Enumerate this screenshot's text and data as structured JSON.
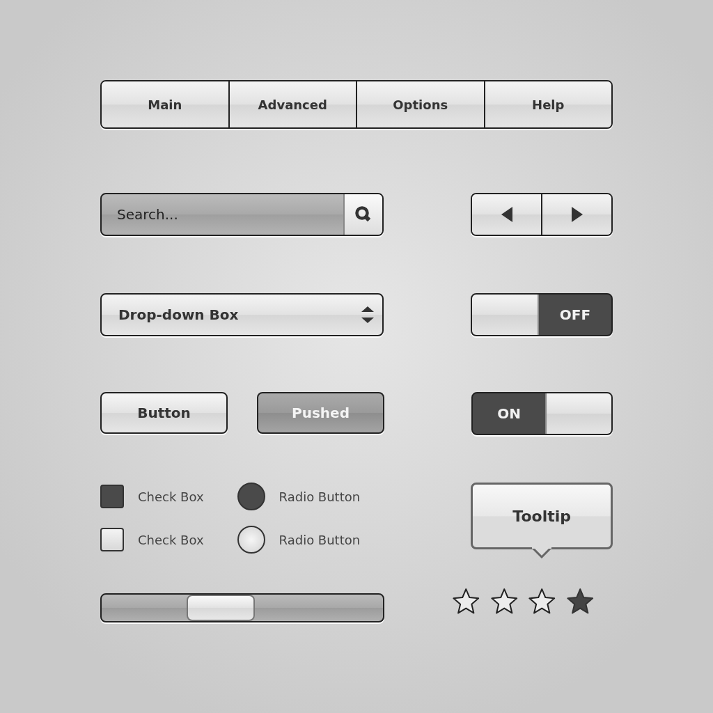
{
  "nav_tabs": [
    {
      "label": "Main"
    },
    {
      "label": "Advanced"
    },
    {
      "label": "Options"
    },
    {
      "label": "Help"
    }
  ],
  "search": {
    "placeholder": "Search..."
  },
  "dropdown": {
    "value": "Drop-down Box"
  },
  "buttons": [
    {
      "label": "Button",
      "pressed": false
    },
    {
      "label": "Pushed",
      "pressed": true
    }
  ],
  "toggles": [
    {
      "label": "OFF",
      "on": false
    },
    {
      "label": "ON",
      "on": true
    }
  ],
  "checkboxes": [
    {
      "label": "Check Box",
      "checked": true
    },
    {
      "label": "Check Box",
      "checked": false
    }
  ],
  "radios": [
    {
      "label": "Radio Button",
      "selected": true
    },
    {
      "label": "Radio Button",
      "selected": false
    }
  ],
  "tooltip": {
    "text": "Tooltip"
  },
  "slider": {
    "level": 0.4
  },
  "rating": {
    "stars": 1
  }
}
